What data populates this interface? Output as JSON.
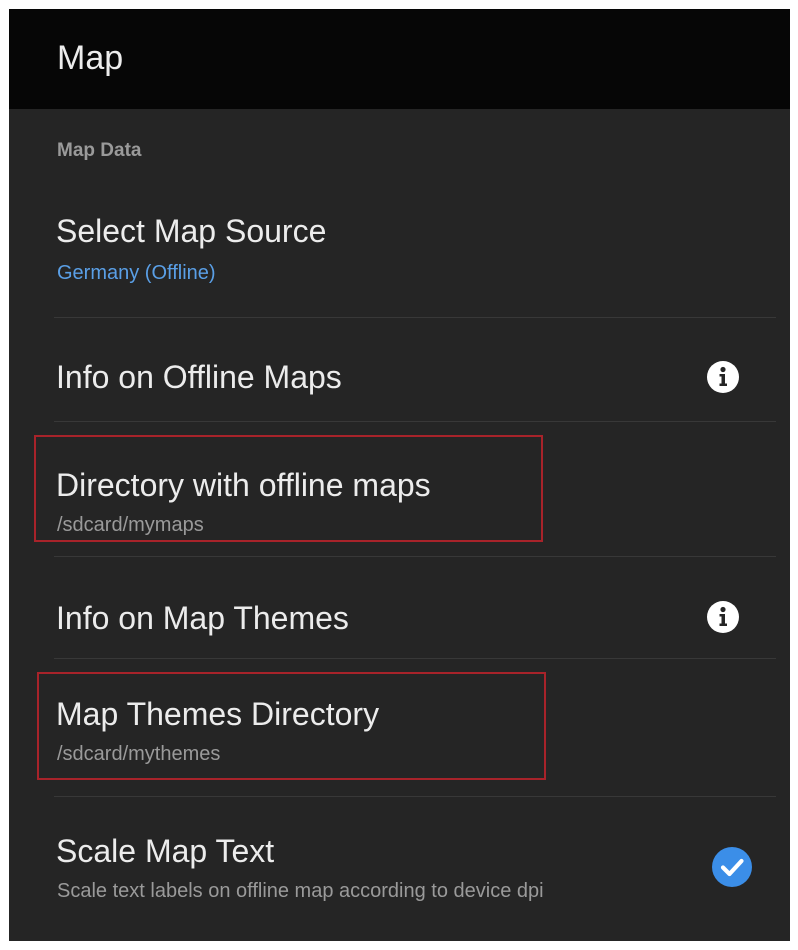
{
  "app_bar": {
    "title": "Map"
  },
  "section": {
    "header": "Map Data"
  },
  "preferences": {
    "map_source": {
      "title": "Select Map Source",
      "summary": "Germany (Offline)"
    },
    "info_offline_maps": {
      "title": "Info on Offline Maps",
      "icon": "info-icon"
    },
    "offline_maps_dir": {
      "title": "Directory with offline maps",
      "summary": "/sdcard/mymaps"
    },
    "info_map_themes": {
      "title": "Info on Map Themes",
      "icon": "info-icon"
    },
    "map_themes_dir": {
      "title": "Map Themes Directory",
      "summary": "/sdcard/mythemes"
    },
    "scale_map_text": {
      "title": "Scale Map Text",
      "summary": "Scale text labels on offline map according to device dpi",
      "checked": true,
      "icon": "check-circle-icon"
    }
  },
  "colors": {
    "background": "#252525",
    "app_bar": "#060606",
    "accent": "#5a9fe6",
    "checkbox": "#3b8ee8",
    "highlight_box": "#a8232a"
  }
}
